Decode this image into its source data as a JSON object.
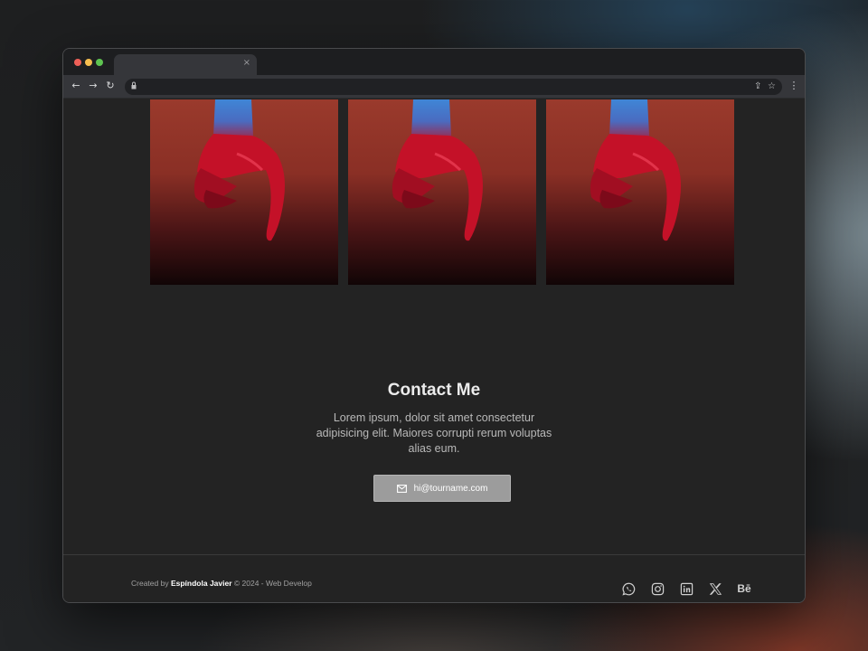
{
  "browser": {
    "tab_close_glyph": "×",
    "nav": {
      "back": "←",
      "forward": "→",
      "reload": "↻"
    },
    "url_icons": {
      "share": "⇪",
      "bookmark": "☆",
      "menu": "⋮"
    }
  },
  "gallery": {
    "images": [
      {
        "alt": "hand-photo-1"
      },
      {
        "alt": "hand-photo-2"
      },
      {
        "alt": "hand-photo-3"
      }
    ]
  },
  "contact": {
    "title": "Contact Me",
    "text": "Lorem ipsum, dolor sit amet consectetur adipisicing elit. Maiores corrupti rerum voluptas alias eum.",
    "email": "hi@tourname.com"
  },
  "footer": {
    "credit_prefix": "Created by",
    "author": "Espíndola Javier",
    "credit_suffix": "© 2024 - Web Develop",
    "socials": [
      "whatsapp-icon",
      "instagram-icon",
      "linkedin-icon",
      "x-icon",
      "behance-icon"
    ],
    "behance_label": "Bē"
  },
  "colors": {
    "page_bg": "#232323",
    "button_bg": "#9c9c9c",
    "accent_red": "#d4102a",
    "accent_blue": "#3a7fd0"
  }
}
